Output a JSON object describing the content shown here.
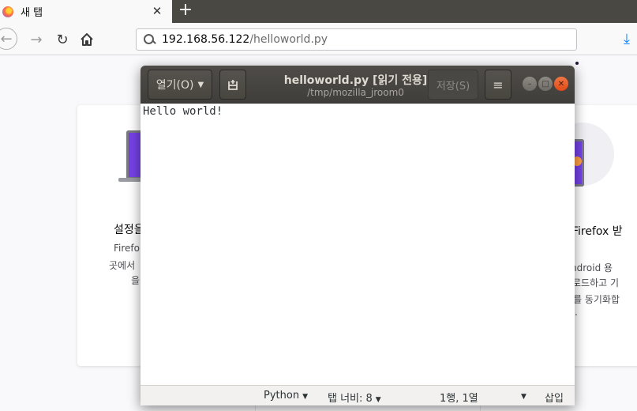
{
  "browser": {
    "tab_title": "새 탭",
    "tab_close": "✕",
    "new_tab": "+",
    "url_host": "192.168.56.122",
    "url_path": "/helloworld.py"
  },
  "page": {
    "left_heading": "설정을",
    "left_line1": "Firefo",
    "left_line2": "곳에서",
    "left_line3": "을",
    "right_heading": "Firefox 받",
    "right_line1": "ndroid 용",
    "right_line2": "로드하고 기",
    "right_line3": "를 동기화합",
    "right_line4": "."
  },
  "gedit": {
    "open_label": "열기(O)",
    "title": "helloworld.py [읽기 전용]",
    "subtitle": "/tmp/mozilla_jroom0",
    "save_label": "저장(S)",
    "editor_text": "Hello world!",
    "status": {
      "language": "Python",
      "tab_width": "탭 너비: 8",
      "position": "1행, 1열",
      "insert_mode": "삽입"
    }
  },
  "colors": {
    "accent": "#0a84ff",
    "gedit_header": "#45433f",
    "close_button": "#e95420"
  }
}
